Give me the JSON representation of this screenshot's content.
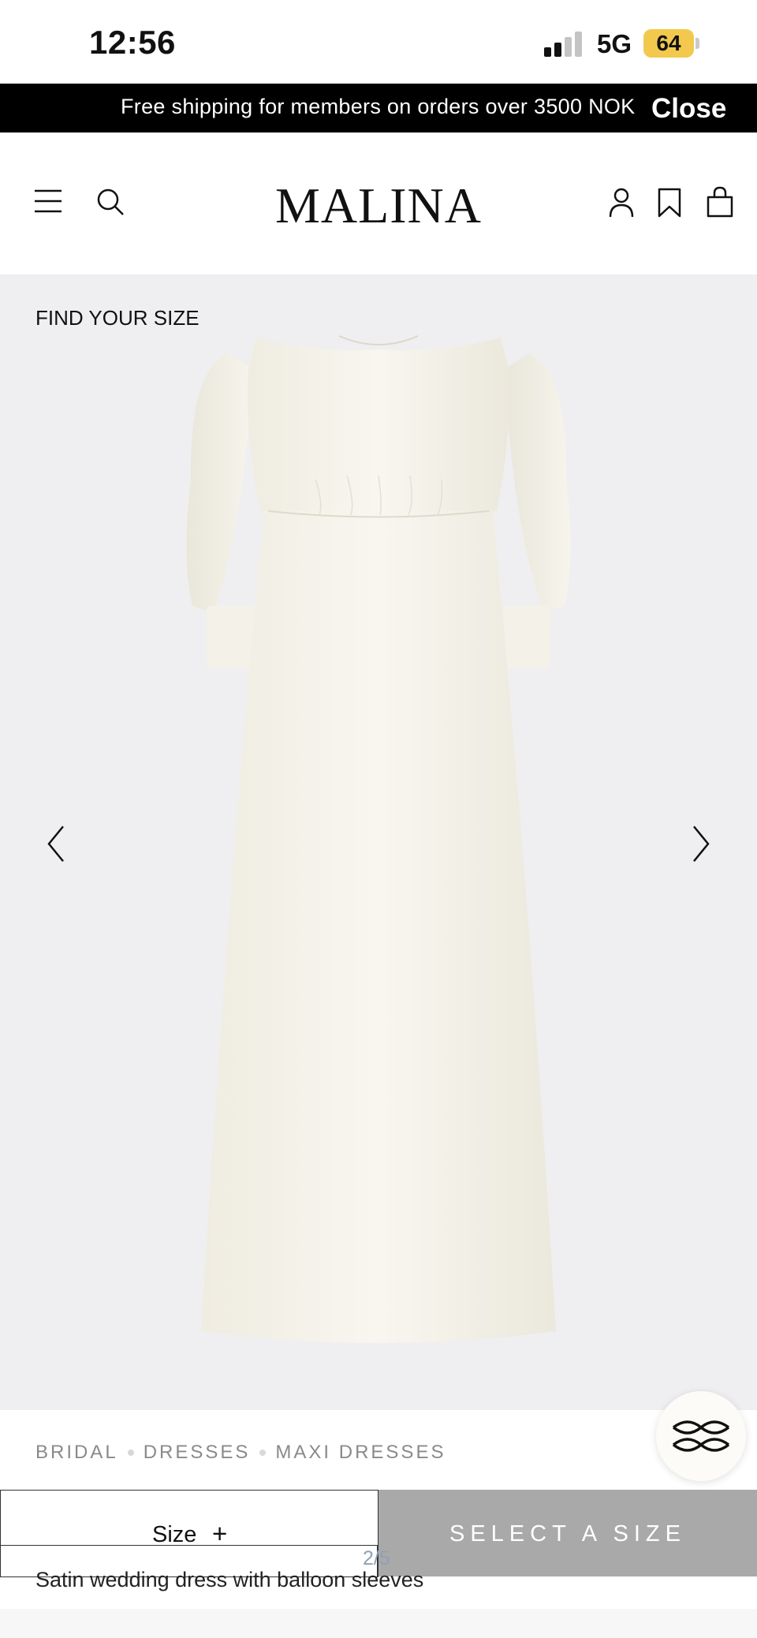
{
  "status_bar": {
    "time": "12:56",
    "network": "5G",
    "battery": "64",
    "battery_color": "#f2c94c"
  },
  "promo": {
    "text": "Free shipping for members on orders over 3500 NOK",
    "close_label": "Close"
  },
  "header": {
    "logo": "MALINA",
    "icons": [
      "menu-icon",
      "search-icon",
      "account-icon",
      "bookmark-icon",
      "bag-icon"
    ]
  },
  "gallery": {
    "find_size_label": "FIND YOUR SIZE",
    "background": "#efeff1",
    "pager": "2/5"
  },
  "breadcrumb": {
    "items": [
      "BRIDAL",
      "DRESSES",
      "MAXI DRESSES"
    ]
  },
  "purchase": {
    "size_label": "Size",
    "size_plus": "+",
    "select_label": "SELECT A SIZE"
  },
  "product": {
    "title": "Satin wedding dress with balloon sleeves"
  }
}
